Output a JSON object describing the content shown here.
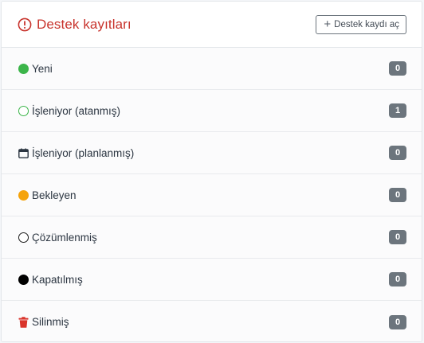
{
  "header": {
    "title": "Destek kayıtları",
    "title_color": "#c8332c",
    "open_button_label": "Destek kaydı aç"
  },
  "statuses": [
    {
      "label": "Yeni",
      "count": "0",
      "icon": "circle-filled-icon",
      "color": "#3cb54a"
    },
    {
      "label": "İşleniyor (atanmış)",
      "count": "1",
      "icon": "circle-outline-icon",
      "color": "#3cb54a"
    },
    {
      "label": "İşleniyor (planlanmış)",
      "count": "0",
      "icon": "calendar-icon",
      "color": "#2b3541"
    },
    {
      "label": "Bekleyen",
      "count": "0",
      "icon": "circle-filled-icon",
      "color": "#f5a30b"
    },
    {
      "label": "Çözümlenmiş",
      "count": "0",
      "icon": "circle-outline-icon",
      "color": "#1b1b1b"
    },
    {
      "label": "Kapatılmış",
      "count": "0",
      "icon": "circle-filled-icon",
      "color": "#000000"
    },
    {
      "label": "Silinmiş",
      "count": "0",
      "icon": "trash-icon",
      "color": "#d9342b"
    }
  ],
  "badge_color": "#6c757d"
}
